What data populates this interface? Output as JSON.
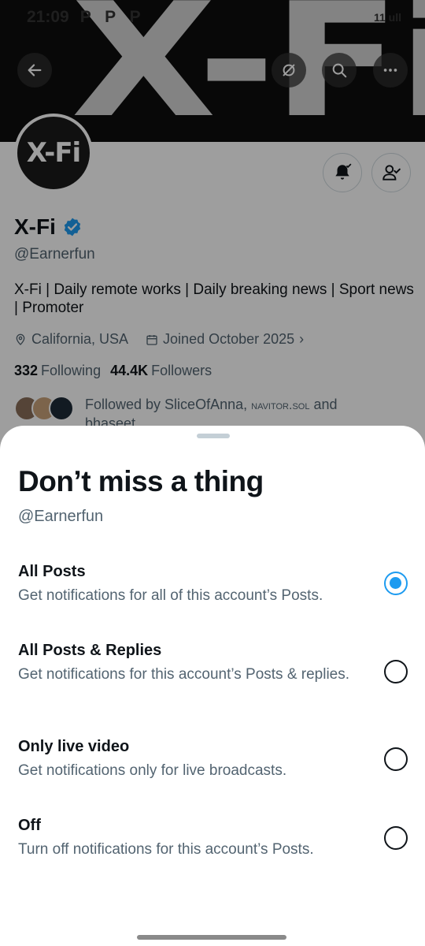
{
  "status_bar": {
    "time": "21:09",
    "app_icons": "P P P",
    "right_indicators": "11 ull"
  },
  "banner": {
    "brand_text": "X-Fi"
  },
  "profile": {
    "avatar_text": "X-Fi",
    "display_name": "X-Fi",
    "handle": "@Earnerfun",
    "bio": "X-Fi | Daily remote works | Daily breaking news | Sport news | Promoter",
    "location": "California, USA",
    "joined": "Joined October 2025",
    "following_count": "332",
    "following_label": "Following",
    "followers_count": "44.4K",
    "followers_label": "Followers",
    "followed_by_prefix": "Followed by SliceOfAnna,",
    "followed_by_mid": "navitor.sol",
    "followed_by_suffix": "and bhaseet"
  },
  "sheet": {
    "title": "Don’t miss a thing",
    "subtitle": "@Earnerfun",
    "options": [
      {
        "title": "All Posts",
        "description": "Get notifications for all of this account’s Posts.",
        "selected": true
      },
      {
        "title": "All Posts & Replies",
        "description": "Get notifications for this account’s Posts & replies.",
        "selected": false
      },
      {
        "title": "Only live video",
        "description": "Get notifications only for live broadcasts.",
        "selected": false
      },
      {
        "title": "Off",
        "description": "Turn off notifications for this account’s Posts.",
        "selected": false
      }
    ]
  },
  "colors": {
    "accent": "#1d9bf0",
    "text_primary": "#0f1419",
    "text_secondary": "#536471"
  },
  "icons": {
    "back": "arrow-left-icon",
    "grok": "grok-icon",
    "search": "search-icon",
    "more": "more-icon",
    "notifications": "bell-check-icon",
    "following": "person-check-icon",
    "verified": "verified-badge-icon",
    "location": "location-pin-icon",
    "calendar": "calendar-icon"
  }
}
